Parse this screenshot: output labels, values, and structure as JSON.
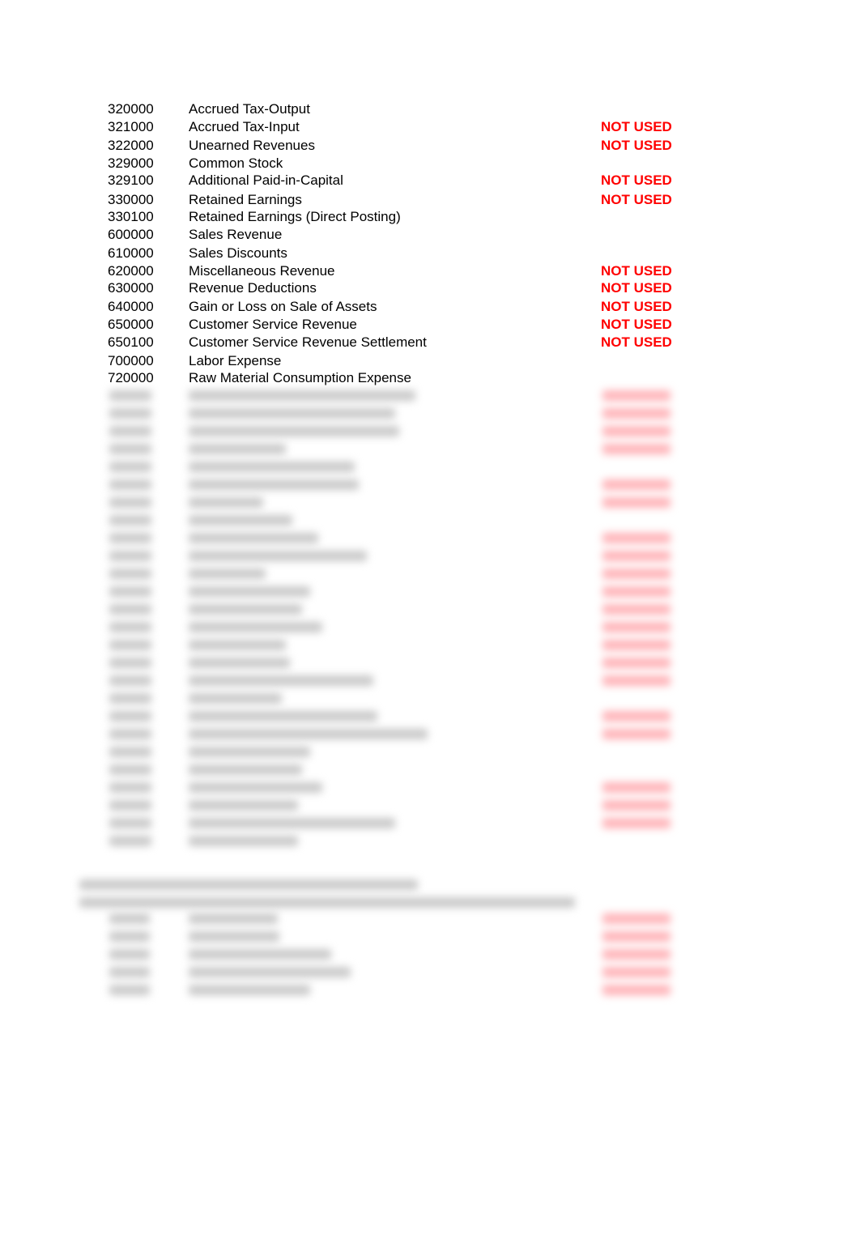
{
  "accounts": [
    {
      "code": "320000",
      "name": "Accrued Tax-Output",
      "status": ""
    },
    {
      "code": "321000",
      "name": "Accrued Tax-Input",
      "status": "NOT USED"
    },
    {
      "code": "322000",
      "name": "Unearned Revenues",
      "status": "NOT USED"
    },
    {
      "code": "329000",
      "name": "Common Stock",
      "status": ""
    },
    {
      "code": "329100",
      "name": "Additional Paid-in-Capital",
      "status": "NOT USED"
    },
    {
      "code": "330000",
      "name": "Retained Earnings",
      "status": "NOT USED"
    },
    {
      "code": "330100",
      "name": "Retained Earnings (Direct Posting)",
      "status": ""
    },
    {
      "code": "600000",
      "name": "Sales Revenue",
      "status": ""
    },
    {
      "code": "610000",
      "name": "Sales Discounts",
      "status": ""
    },
    {
      "code": "620000",
      "name": "Miscellaneous Revenue",
      "status": "NOT USED"
    },
    {
      "code": "630000",
      "name": "Revenue Deductions",
      "status": "NOT USED"
    },
    {
      "code": "640000",
      "name": "Gain or Loss on Sale of Assets",
      "status": "NOT USED"
    },
    {
      "code": "650000",
      "name": "Customer Service Revenue",
      "status": "NOT USED"
    },
    {
      "code": "650100",
      "name": "Customer Service Revenue Settlement",
      "status": "NOT USED"
    },
    {
      "code": "700000",
      "name": "Labor Expense",
      "status": ""
    },
    {
      "code": "720000",
      "name": "Raw Material Consumption Expense",
      "status": ""
    }
  ],
  "colors": {
    "not_used": "#ff0000"
  }
}
